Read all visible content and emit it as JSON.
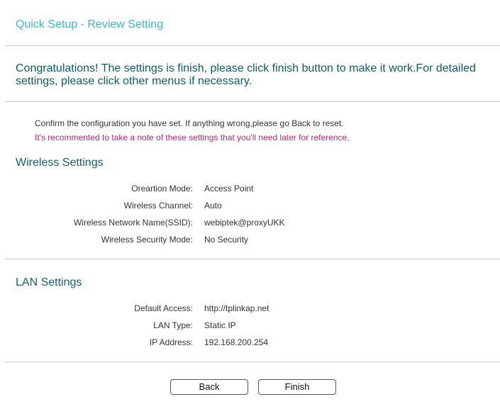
{
  "header": {
    "title": "Quick Setup - Review Setting"
  },
  "intro": {
    "congratulations": "Congratulations! The settings is finish, please click finish button to make it work.For detailed settings, please click other menus if necessary.",
    "confirm_note": "Confirm the configuration you have set. If anything wrong,please go Back to reset.",
    "recommend_note": "It's recommented to take a note of these settings that you'll need later for reference."
  },
  "wireless": {
    "title": "Wireless Settings",
    "rows": [
      {
        "label": "Oreartion Mode:",
        "value": "Access Point"
      },
      {
        "label": "Wireless Channel:",
        "value": "Auto"
      },
      {
        "label": "Wireless Network Name(SSID):",
        "value": "webiptek@proxyUKK"
      },
      {
        "label": "Wireless Security Mode:",
        "value": "No Security"
      }
    ]
  },
  "lan": {
    "title": "LAN Settings",
    "rows": [
      {
        "label": "Default Access:",
        "value": "http://tplinkap.net"
      },
      {
        "label": "LAN Type:",
        "value": "Static IP"
      },
      {
        "label": "IP Address:",
        "value": "192.168.200.254"
      }
    ]
  },
  "buttons": {
    "back": "Back",
    "finish": "Finish"
  },
  "colors": {
    "title_accent": "#3fb8c4",
    "heading_teal": "#0e5c66",
    "warning_magenta": "#c0266e"
  }
}
